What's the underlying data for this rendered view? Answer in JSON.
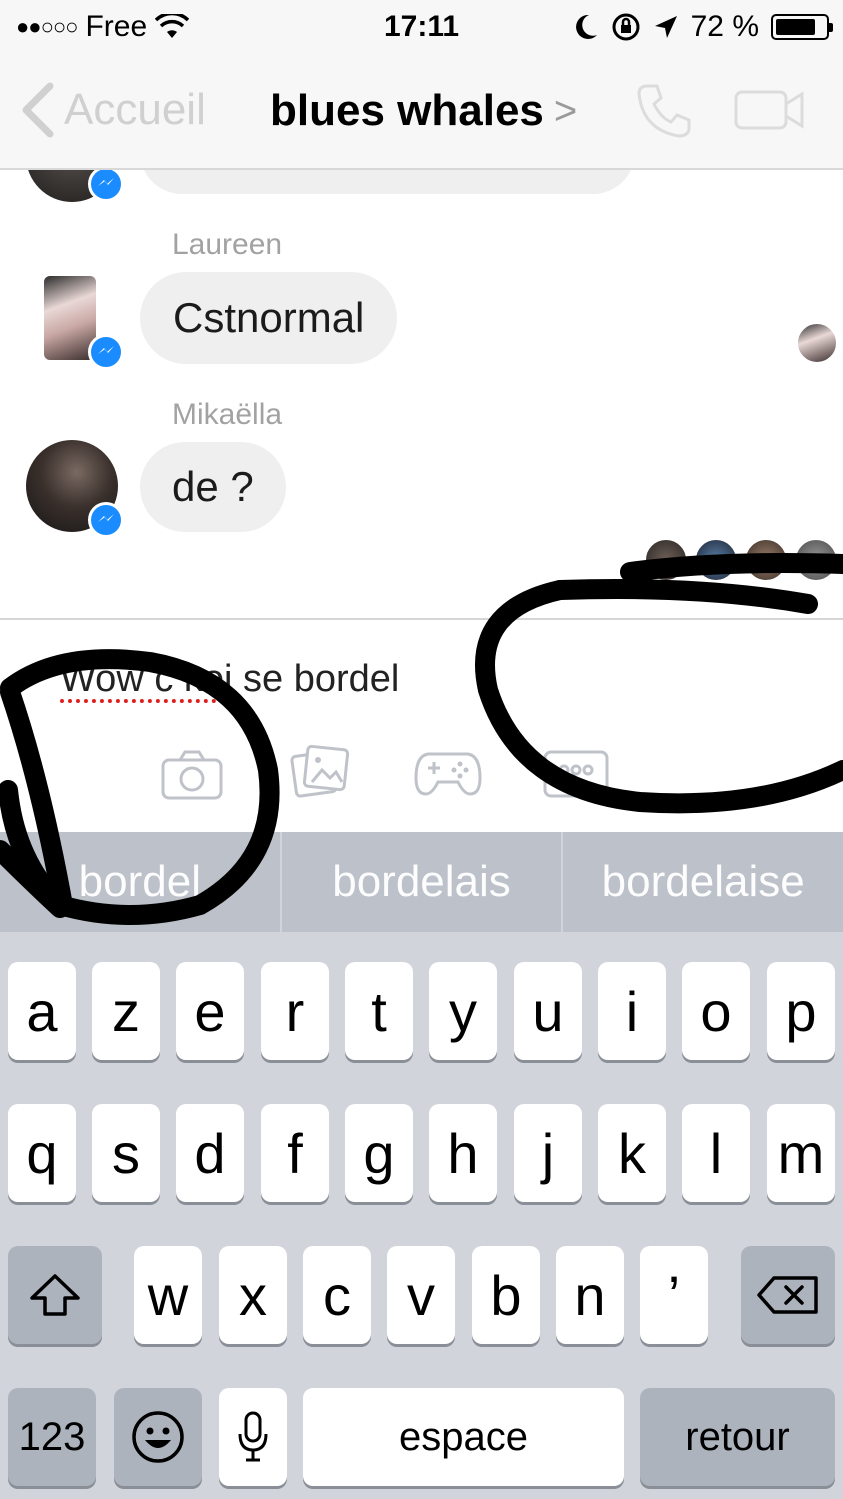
{
  "status_bar": {
    "carrier": "Free",
    "time": "17:11",
    "battery": "72 %",
    "battery_level": 0.72
  },
  "nav": {
    "back_label": "Accueil",
    "title": "blues whales",
    "title_chevron": ">",
    "call_icon": "phone-icon",
    "video_icon": "video-camera-icon"
  },
  "messages": [
    {
      "sender": "Laureen",
      "text": "Cstnormal"
    },
    {
      "sender": "Mikaëlla",
      "text": "de ?"
    }
  ],
  "composer": {
    "text_misspelled": "Wow c koi",
    "text_rest": " se bordel",
    "tools": [
      "camera-icon",
      "gallery-icon",
      "game-controller-icon",
      "more-icon"
    ]
  },
  "keyboard": {
    "suggestions": [
      "bordel",
      "bordelais",
      "bordelaise"
    ],
    "row1": [
      "a",
      "z",
      "e",
      "r",
      "t",
      "y",
      "u",
      "i",
      "o",
      "p"
    ],
    "row2": [
      "q",
      "s",
      "d",
      "f",
      "g",
      "h",
      "j",
      "k",
      "l",
      "m"
    ],
    "row3": [
      "w",
      "x",
      "c",
      "v",
      "b",
      "n",
      "’"
    ],
    "numbers_key": "123",
    "space_key": "espace",
    "return_key": "retour"
  },
  "colors": {
    "messenger_blue": "#1a8cff",
    "bubble_gray": "#efefef",
    "keyboard_bg": "#d1d5db",
    "suggestion_bar": "#bcc1ca"
  }
}
